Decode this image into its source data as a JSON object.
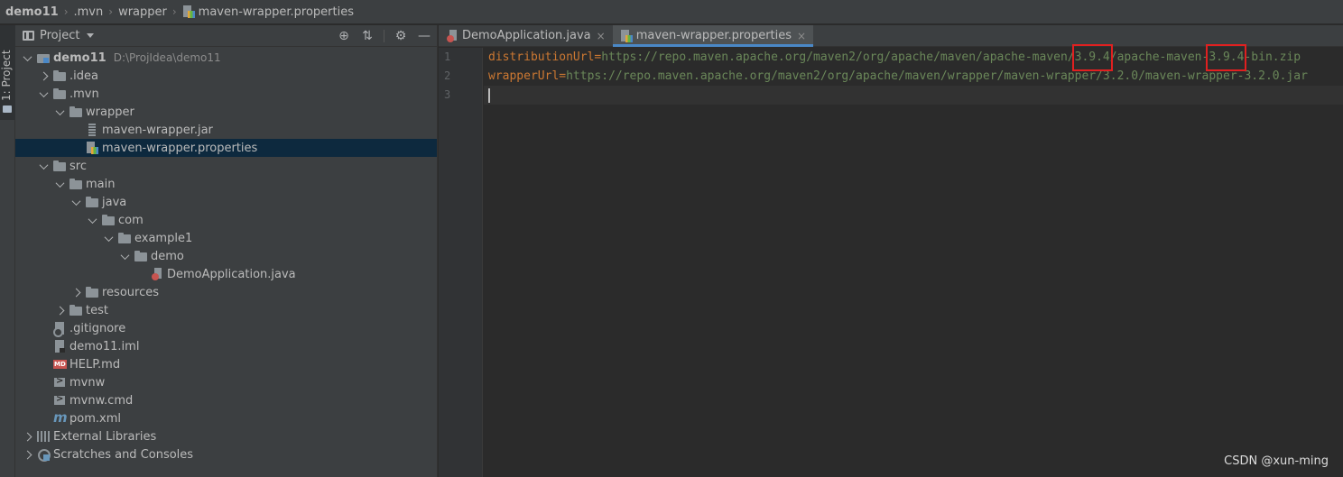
{
  "breadcrumb": [
    "demo11",
    ".mvn",
    "wrapper",
    "maven-wrapper.properties"
  ],
  "stripe": {
    "label": "1: Project"
  },
  "panel": {
    "title": "Project"
  },
  "tree": [
    {
      "label": "demo11",
      "extra": "D:\\ProjIdea\\demo11",
      "depth": 0,
      "arrow": "down",
      "icon": "module",
      "bold": true,
      "name": "tree-item-demo11"
    },
    {
      "label": ".idea",
      "depth": 1,
      "arrow": "right",
      "icon": "folder",
      "name": "tree-item-idea"
    },
    {
      "label": ".mvn",
      "depth": 1,
      "arrow": "down",
      "icon": "folder",
      "name": "tree-item-mvn"
    },
    {
      "label": "wrapper",
      "depth": 2,
      "arrow": "down",
      "icon": "folder",
      "name": "tree-item-wrapper"
    },
    {
      "label": "maven-wrapper.jar",
      "depth": 3,
      "arrow": "none",
      "icon": "jar",
      "name": "tree-item-maven-wrapper-jar"
    },
    {
      "label": "maven-wrapper.properties",
      "depth": 3,
      "arrow": "none",
      "icon": "props",
      "selected": true,
      "name": "tree-item-maven-wrapper-properties"
    },
    {
      "label": "src",
      "depth": 1,
      "arrow": "down",
      "icon": "folder",
      "name": "tree-item-src"
    },
    {
      "label": "main",
      "depth": 2,
      "arrow": "down",
      "icon": "folder",
      "name": "tree-item-main"
    },
    {
      "label": "java",
      "depth": 3,
      "arrow": "down",
      "icon": "folder",
      "name": "tree-item-java"
    },
    {
      "label": "com",
      "depth": 4,
      "arrow": "down",
      "icon": "folder",
      "name": "tree-item-com"
    },
    {
      "label": "example1",
      "depth": 5,
      "arrow": "down",
      "icon": "folder",
      "name": "tree-item-example1"
    },
    {
      "label": "demo",
      "depth": 6,
      "arrow": "down",
      "icon": "folder",
      "name": "tree-item-demo"
    },
    {
      "label": "DemoApplication.java",
      "depth": 7,
      "arrow": "none",
      "icon": "java",
      "name": "tree-item-demoapplication-java"
    },
    {
      "label": "resources",
      "depth": 3,
      "arrow": "right",
      "icon": "folder",
      "name": "tree-item-resources"
    },
    {
      "label": "test",
      "depth": 2,
      "arrow": "right",
      "icon": "folder",
      "name": "tree-item-test"
    },
    {
      "label": ".gitignore",
      "depth": 1,
      "arrow": "none",
      "icon": "git",
      "name": "tree-item-gitignore"
    },
    {
      "label": "demo11.iml",
      "depth": 1,
      "arrow": "none",
      "icon": "iml",
      "name": "tree-item-demo11-iml"
    },
    {
      "label": "HELP.md",
      "depth": 1,
      "arrow": "none",
      "icon": "md",
      "name": "tree-item-help-md"
    },
    {
      "label": "mvnw",
      "depth": 1,
      "arrow": "none",
      "icon": "term",
      "name": "tree-item-mvnw"
    },
    {
      "label": "mvnw.cmd",
      "depth": 1,
      "arrow": "none",
      "icon": "term",
      "name": "tree-item-mvnw-cmd"
    },
    {
      "label": "pom.xml",
      "depth": 1,
      "arrow": "none",
      "icon": "mvn",
      "name": "tree-item-pom-xml"
    },
    {
      "label": "External Libraries",
      "depth": 0,
      "arrow": "right",
      "icon": "libs",
      "name": "tree-item-external-libraries"
    },
    {
      "label": "Scratches and Consoles",
      "depth": 0,
      "arrow": "right",
      "icon": "scratch",
      "name": "tree-item-scratches"
    }
  ],
  "tabs": [
    {
      "label": "DemoApplication.java",
      "icon": "java",
      "active": false
    },
    {
      "label": "maven-wrapper.properties",
      "icon": "props",
      "active": true
    }
  ],
  "code": {
    "line_numbers": [
      "1",
      "2",
      "3"
    ],
    "lines": [
      {
        "key": "distributionUrl",
        "eq": "=",
        "value": "https://repo.maven.apache.org/maven2/org/apache/maven/apache-maven/3.9.4/apache-maven-3.9.4-bin.zip"
      },
      {
        "key": "wrapperUrl",
        "eq": "=",
        "value": "https://repo.maven.apache.org/maven2/org/apache/maven/wrapper/maven-wrapper/3.2.0/maven-wrapper-3.2.0.jar"
      },
      {
        "key": "",
        "eq": "",
        "value": ""
      }
    ]
  },
  "highlight_color": "#e02020",
  "watermark": "CSDN @xun-ming"
}
